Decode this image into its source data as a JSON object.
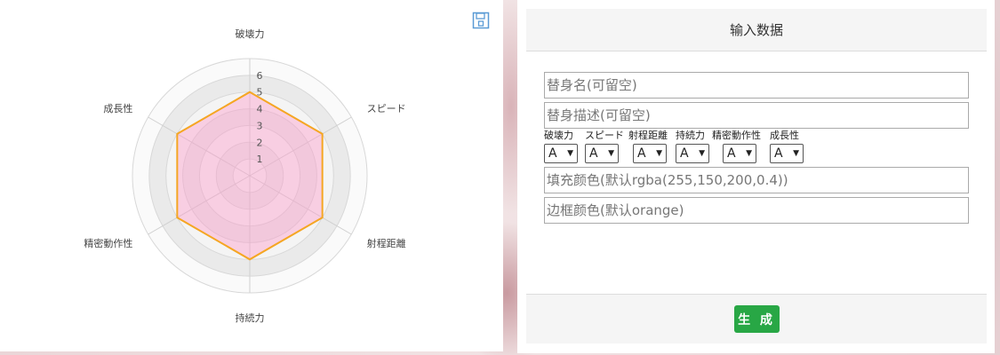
{
  "form": {
    "header": "输入数据",
    "name_placeholder": "替身名(可留空)",
    "desc_placeholder": "替身描述(可留空)",
    "fill_placeholder": "填充颜色(默认rgba(255,150,200,0.4))",
    "border_placeholder": "边框颜色(默认orange)",
    "attributes": [
      {
        "label": "破壊力",
        "value": "A"
      },
      {
        "label": "スピード",
        "value": "A"
      },
      {
        "label": "射程距離",
        "value": "A"
      },
      {
        "label": "持続力",
        "value": "A"
      },
      {
        "label": "精密動作性",
        "value": "A"
      },
      {
        "label": "成長性",
        "value": "A"
      }
    ],
    "generate_label": "生 成"
  },
  "chart_data": {
    "type": "radar",
    "categories": [
      "破壊力",
      "スピード",
      "射程距離",
      "持続力",
      "精密動作性",
      "成長性"
    ],
    "values": [
      5,
      5,
      5,
      5,
      5,
      5
    ],
    "ticks": [
      "1",
      "2",
      "3",
      "4",
      "5",
      "6"
    ],
    "rlim": [
      0,
      6
    ],
    "fill_color": "rgba(255,150,200,0.4)",
    "line_color": "#f5a623",
    "grid": true
  },
  "icons": {
    "save": "save-icon"
  },
  "colors": {
    "accent": "#28a745",
    "save_icon": "#5b9bd5"
  }
}
